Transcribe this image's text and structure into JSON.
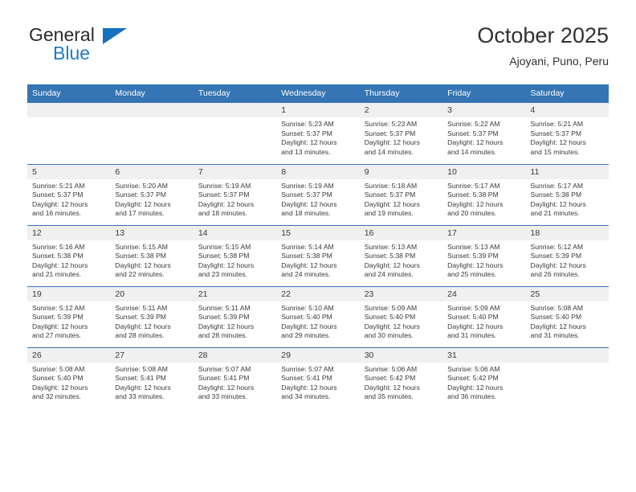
{
  "brand": {
    "name_top": "General",
    "name_bottom": "Blue",
    "triangle_color": "#1570c0",
    "text_color": "#2b2b2b",
    "blue_color": "#1f7cc4"
  },
  "header": {
    "title": "October 2025",
    "subtitle": "Ajoyani, Puno, Peru"
  },
  "theme": {
    "header_blue": "#3575b4",
    "daynum_gray": "#f0f0f0",
    "text": "#3a3a3a"
  },
  "weekdays": [
    "Sunday",
    "Monday",
    "Tuesday",
    "Wednesday",
    "Thursday",
    "Friday",
    "Saturday"
  ],
  "weeks": [
    [
      {
        "day": "",
        "lines": []
      },
      {
        "day": "",
        "lines": []
      },
      {
        "day": "",
        "lines": []
      },
      {
        "day": "1",
        "lines": [
          "Sunrise: 5:23 AM",
          "Sunset: 5:37 PM",
          "Daylight: 12 hours",
          "and 13 minutes."
        ]
      },
      {
        "day": "2",
        "lines": [
          "Sunrise: 5:23 AM",
          "Sunset: 5:37 PM",
          "Daylight: 12 hours",
          "and 14 minutes."
        ]
      },
      {
        "day": "3",
        "lines": [
          "Sunrise: 5:22 AM",
          "Sunset: 5:37 PM",
          "Daylight: 12 hours",
          "and 14 minutes."
        ]
      },
      {
        "day": "4",
        "lines": [
          "Sunrise: 5:21 AM",
          "Sunset: 5:37 PM",
          "Daylight: 12 hours",
          "and 15 minutes."
        ]
      }
    ],
    [
      {
        "day": "5",
        "lines": [
          "Sunrise: 5:21 AM",
          "Sunset: 5:37 PM",
          "Daylight: 12 hours",
          "and 16 minutes."
        ]
      },
      {
        "day": "6",
        "lines": [
          "Sunrise: 5:20 AM",
          "Sunset: 5:37 PM",
          "Daylight: 12 hours",
          "and 17 minutes."
        ]
      },
      {
        "day": "7",
        "lines": [
          "Sunrise: 5:19 AM",
          "Sunset: 5:37 PM",
          "Daylight: 12 hours",
          "and 18 minutes."
        ]
      },
      {
        "day": "8",
        "lines": [
          "Sunrise: 5:19 AM",
          "Sunset: 5:37 PM",
          "Daylight: 12 hours",
          "and 18 minutes."
        ]
      },
      {
        "day": "9",
        "lines": [
          "Sunrise: 5:18 AM",
          "Sunset: 5:37 PM",
          "Daylight: 12 hours",
          "and 19 minutes."
        ]
      },
      {
        "day": "10",
        "lines": [
          "Sunrise: 5:17 AM",
          "Sunset: 5:38 PM",
          "Daylight: 12 hours",
          "and 20 minutes."
        ]
      },
      {
        "day": "11",
        "lines": [
          "Sunrise: 5:17 AM",
          "Sunset: 5:38 PM",
          "Daylight: 12 hours",
          "and 21 minutes."
        ]
      }
    ],
    [
      {
        "day": "12",
        "lines": [
          "Sunrise: 5:16 AM",
          "Sunset: 5:38 PM",
          "Daylight: 12 hours",
          "and 21 minutes."
        ]
      },
      {
        "day": "13",
        "lines": [
          "Sunrise: 5:15 AM",
          "Sunset: 5:38 PM",
          "Daylight: 12 hours",
          "and 22 minutes."
        ]
      },
      {
        "day": "14",
        "lines": [
          "Sunrise: 5:15 AM",
          "Sunset: 5:38 PM",
          "Daylight: 12 hours",
          "and 23 minutes."
        ]
      },
      {
        "day": "15",
        "lines": [
          "Sunrise: 5:14 AM",
          "Sunset: 5:38 PM",
          "Daylight: 12 hours",
          "and 24 minutes."
        ]
      },
      {
        "day": "16",
        "lines": [
          "Sunrise: 5:13 AM",
          "Sunset: 5:38 PM",
          "Daylight: 12 hours",
          "and 24 minutes."
        ]
      },
      {
        "day": "17",
        "lines": [
          "Sunrise: 5:13 AM",
          "Sunset: 5:39 PM",
          "Daylight: 12 hours",
          "and 25 minutes."
        ]
      },
      {
        "day": "18",
        "lines": [
          "Sunrise: 5:12 AM",
          "Sunset: 5:39 PM",
          "Daylight: 12 hours",
          "and 26 minutes."
        ]
      }
    ],
    [
      {
        "day": "19",
        "lines": [
          "Sunrise: 5:12 AM",
          "Sunset: 5:39 PM",
          "Daylight: 12 hours",
          "and 27 minutes."
        ]
      },
      {
        "day": "20",
        "lines": [
          "Sunrise: 5:11 AM",
          "Sunset: 5:39 PM",
          "Daylight: 12 hours",
          "and 28 minutes."
        ]
      },
      {
        "day": "21",
        "lines": [
          "Sunrise: 5:11 AM",
          "Sunset: 5:39 PM",
          "Daylight: 12 hours",
          "and 28 minutes."
        ]
      },
      {
        "day": "22",
        "lines": [
          "Sunrise: 5:10 AM",
          "Sunset: 5:40 PM",
          "Daylight: 12 hours",
          "and 29 minutes."
        ]
      },
      {
        "day": "23",
        "lines": [
          "Sunrise: 5:09 AM",
          "Sunset: 5:40 PM",
          "Daylight: 12 hours",
          "and 30 minutes."
        ]
      },
      {
        "day": "24",
        "lines": [
          "Sunrise: 5:09 AM",
          "Sunset: 5:40 PM",
          "Daylight: 12 hours",
          "and 31 minutes."
        ]
      },
      {
        "day": "25",
        "lines": [
          "Sunrise: 5:08 AM",
          "Sunset: 5:40 PM",
          "Daylight: 12 hours",
          "and 31 minutes."
        ]
      }
    ],
    [
      {
        "day": "26",
        "lines": [
          "Sunrise: 5:08 AM",
          "Sunset: 5:40 PM",
          "Daylight: 12 hours",
          "and 32 minutes."
        ]
      },
      {
        "day": "27",
        "lines": [
          "Sunrise: 5:08 AM",
          "Sunset: 5:41 PM",
          "Daylight: 12 hours",
          "and 33 minutes."
        ]
      },
      {
        "day": "28",
        "lines": [
          "Sunrise: 5:07 AM",
          "Sunset: 5:41 PM",
          "Daylight: 12 hours",
          "and 33 minutes."
        ]
      },
      {
        "day": "29",
        "lines": [
          "Sunrise: 5:07 AM",
          "Sunset: 5:41 PM",
          "Daylight: 12 hours",
          "and 34 minutes."
        ]
      },
      {
        "day": "30",
        "lines": [
          "Sunrise: 5:06 AM",
          "Sunset: 5:42 PM",
          "Daylight: 12 hours",
          "and 35 minutes."
        ]
      },
      {
        "day": "31",
        "lines": [
          "Sunrise: 5:06 AM",
          "Sunset: 5:42 PM",
          "Daylight: 12 hours",
          "and 36 minutes."
        ]
      },
      {
        "day": "",
        "lines": []
      }
    ]
  ]
}
